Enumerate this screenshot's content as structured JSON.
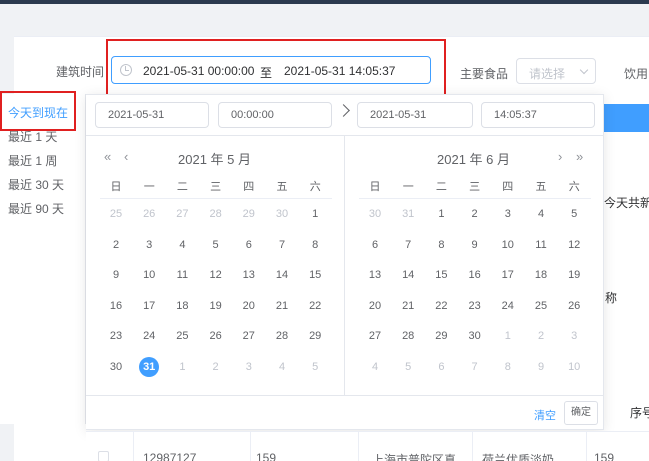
{
  "filters": {
    "build_time_label": "建筑时间",
    "start_datetime": "2021-05-31 00:00:00",
    "range_separator": "至",
    "end_datetime": "2021-05-31 14:05:37",
    "main_food_label": "主要食品",
    "main_food_placeholder": "请选择",
    "drink_label": "饮用"
  },
  "shortcuts": [
    "今天到现在",
    "最近 1 天",
    "最近 1 周",
    "最近 30 天",
    "最近 90 天"
  ],
  "picker": {
    "start_date": "2021-05-31",
    "start_time": "00:00:00",
    "end_date": "2021-05-31",
    "end_time": "14:05:37",
    "nav_prev_year": "«",
    "nav_prev_month": "‹",
    "nav_next_month": "›",
    "nav_next_year": "»",
    "left_title": "2021 年 5 月",
    "right_title": "2021 年 6 月",
    "weekdays": [
      "日",
      "一",
      "二",
      "三",
      "四",
      "五",
      "六"
    ],
    "left_days": [
      [
        "25",
        "26",
        "27",
        "28",
        "29",
        "30",
        "1"
      ],
      [
        "2",
        "3",
        "4",
        "5",
        "6",
        "7",
        "8"
      ],
      [
        "9",
        "10",
        "11",
        "12",
        "13",
        "14",
        "15"
      ],
      [
        "16",
        "17",
        "18",
        "19",
        "20",
        "21",
        "22"
      ],
      [
        "23",
        "24",
        "25",
        "26",
        "27",
        "28",
        "29"
      ],
      [
        "30",
        "31",
        "1",
        "2",
        "3",
        "4",
        "5"
      ]
    ],
    "right_days": [
      [
        "30",
        "31",
        "1",
        "2",
        "3",
        "4",
        "5"
      ],
      [
        "6",
        "7",
        "8",
        "9",
        "10",
        "11",
        "12"
      ],
      [
        "13",
        "14",
        "15",
        "16",
        "17",
        "18",
        "19"
      ],
      [
        "20",
        "21",
        "22",
        "23",
        "24",
        "25",
        "26"
      ],
      [
        "27",
        "28",
        "29",
        "30",
        "1",
        "2",
        "3"
      ],
      [
        "4",
        "5",
        "6",
        "7",
        "8",
        "9",
        "10"
      ]
    ],
    "clear_label": "清空",
    "confirm_label": "确定"
  },
  "background": {
    "today_new_text": "今天共新",
    "col_name": "称",
    "col_index": "序号"
  },
  "table_row": {
    "id": "12987127",
    "num": "159",
    "address": "上海市普陀区真...",
    "product": "荷兰优质淡奶,...",
    "last": "159"
  }
}
